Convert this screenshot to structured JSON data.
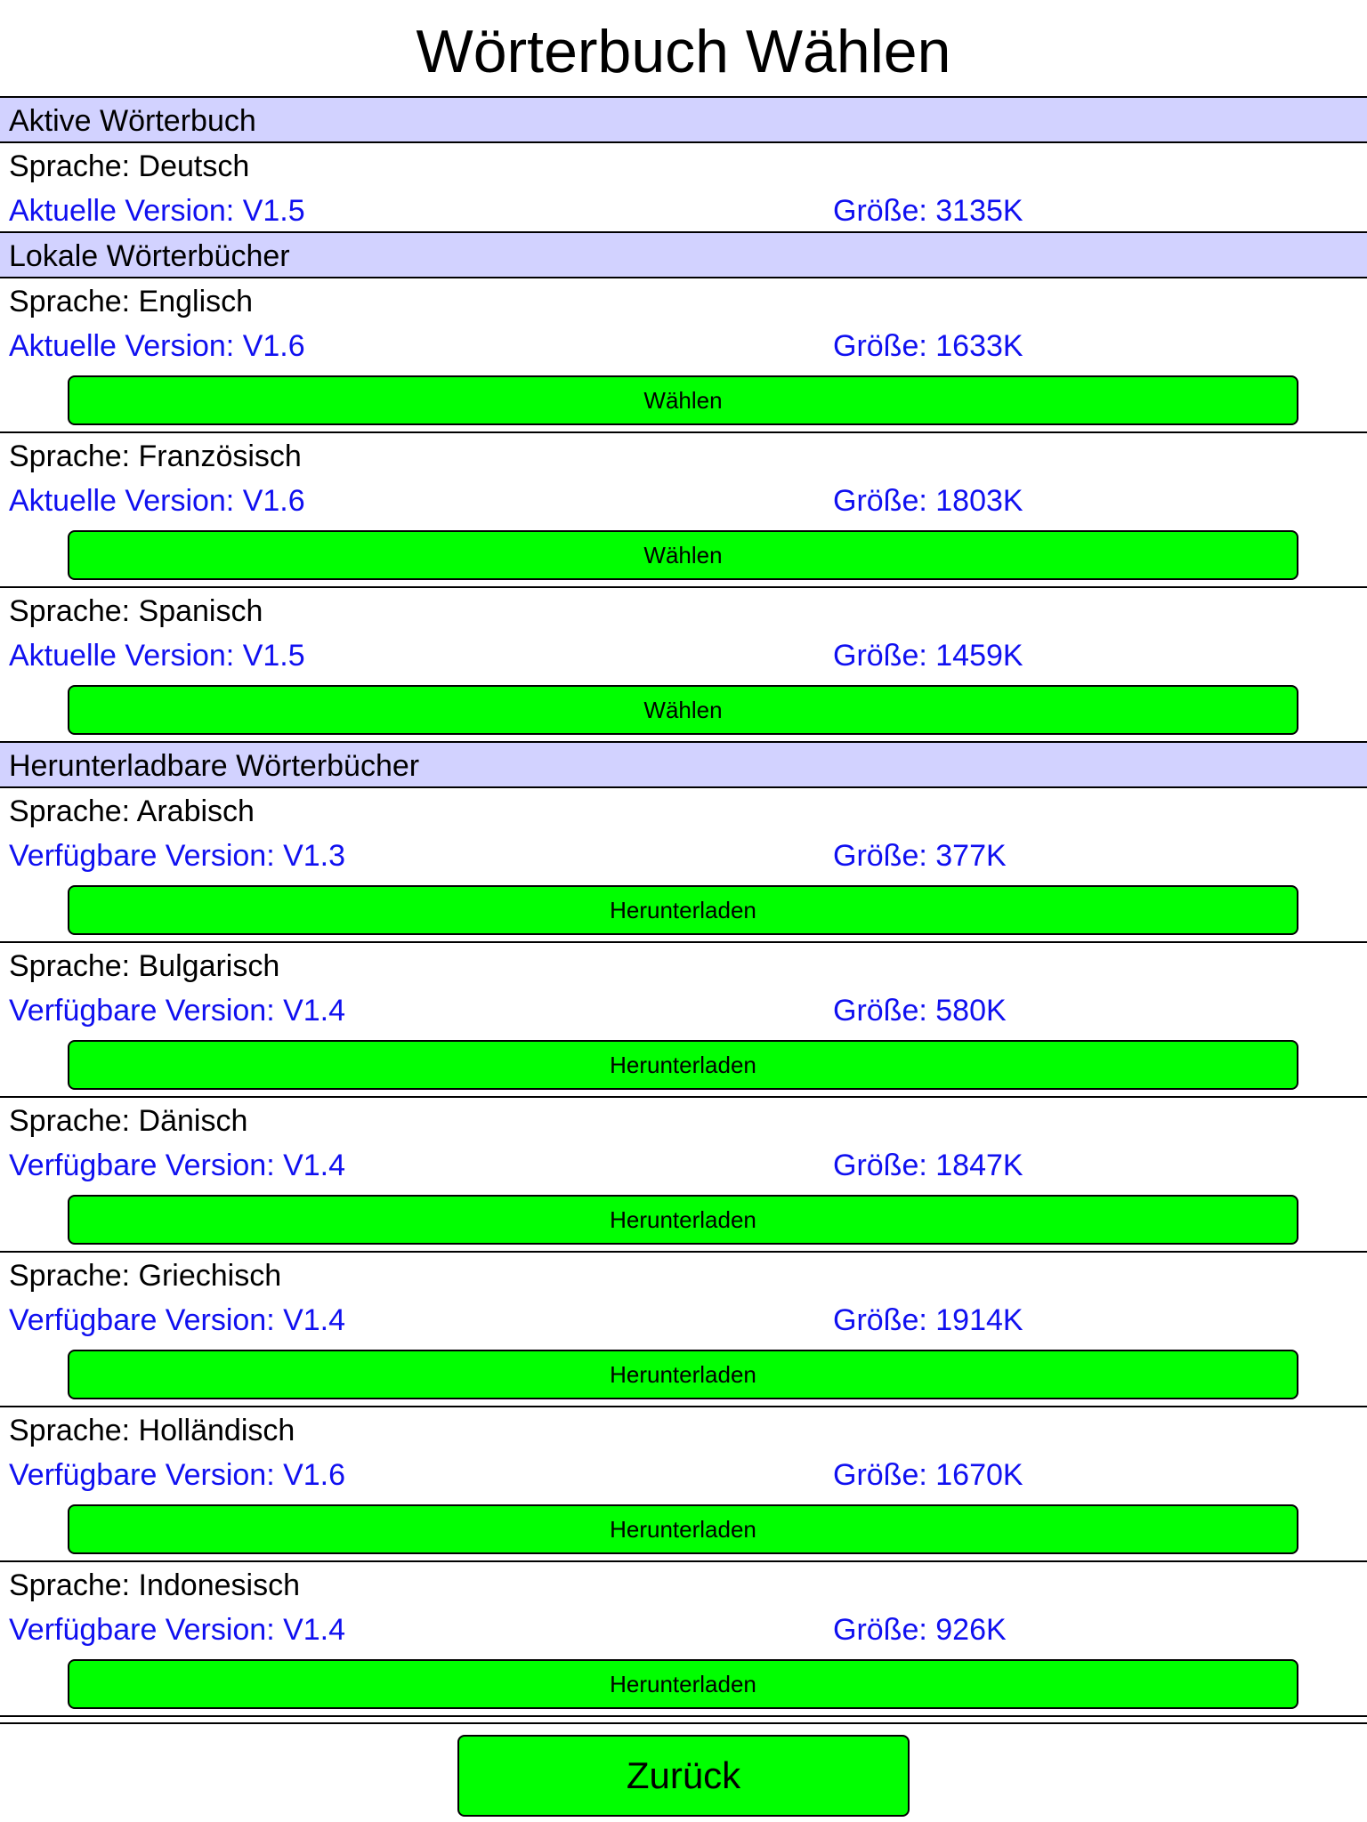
{
  "title": "Wörterbuch Wählen",
  "sections": {
    "active": {
      "header": "Aktive Wörterbuch",
      "item": {
        "language": "Sprache: Deutsch",
        "version": "Aktuelle Version: V1.5",
        "size": "Größe: 3135K"
      }
    },
    "local": {
      "header": "Lokale Wörterbücher",
      "items": [
        {
          "language": "Sprache: Englisch",
          "version": "Aktuelle Version: V1.6",
          "size": "Größe: 1633K",
          "button": "Wählen"
        },
        {
          "language": "Sprache: Französisch",
          "version": "Aktuelle Version: V1.6",
          "size": "Größe: 1803K",
          "button": "Wählen"
        },
        {
          "language": "Sprache: Spanisch",
          "version": "Aktuelle Version: V1.5",
          "size": "Größe: 1459K",
          "button": "Wählen"
        }
      ]
    },
    "downloadable": {
      "header": "Herunterladbare Wörterbücher",
      "items": [
        {
          "language": "Sprache: Arabisch",
          "version": "Verfügbare Version: V1.3",
          "size": "Größe: 377K",
          "button": "Herunterladen"
        },
        {
          "language": "Sprache: Bulgarisch",
          "version": "Verfügbare Version: V1.4",
          "size": "Größe: 580K",
          "button": "Herunterladen"
        },
        {
          "language": "Sprache: Dänisch",
          "version": "Verfügbare Version: V1.4",
          "size": "Größe: 1847K",
          "button": "Herunterladen"
        },
        {
          "language": "Sprache: Griechisch",
          "version": "Verfügbare Version: V1.4",
          "size": "Größe: 1914K",
          "button": "Herunterladen"
        },
        {
          "language": "Sprache: Holländisch",
          "version": "Verfügbare Version: V1.6",
          "size": "Größe: 1670K",
          "button": "Herunterladen"
        },
        {
          "language": "Sprache: Indonesisch",
          "version": "Verfügbare Version: V1.4",
          "size": "Größe: 926K",
          "button": "Herunterladen"
        }
      ]
    }
  },
  "back_button": "Zurück",
  "colors": {
    "section_header_bg": "#d2d2ff",
    "button_green": "#00ff00",
    "link_blue": "#1010f0"
  }
}
